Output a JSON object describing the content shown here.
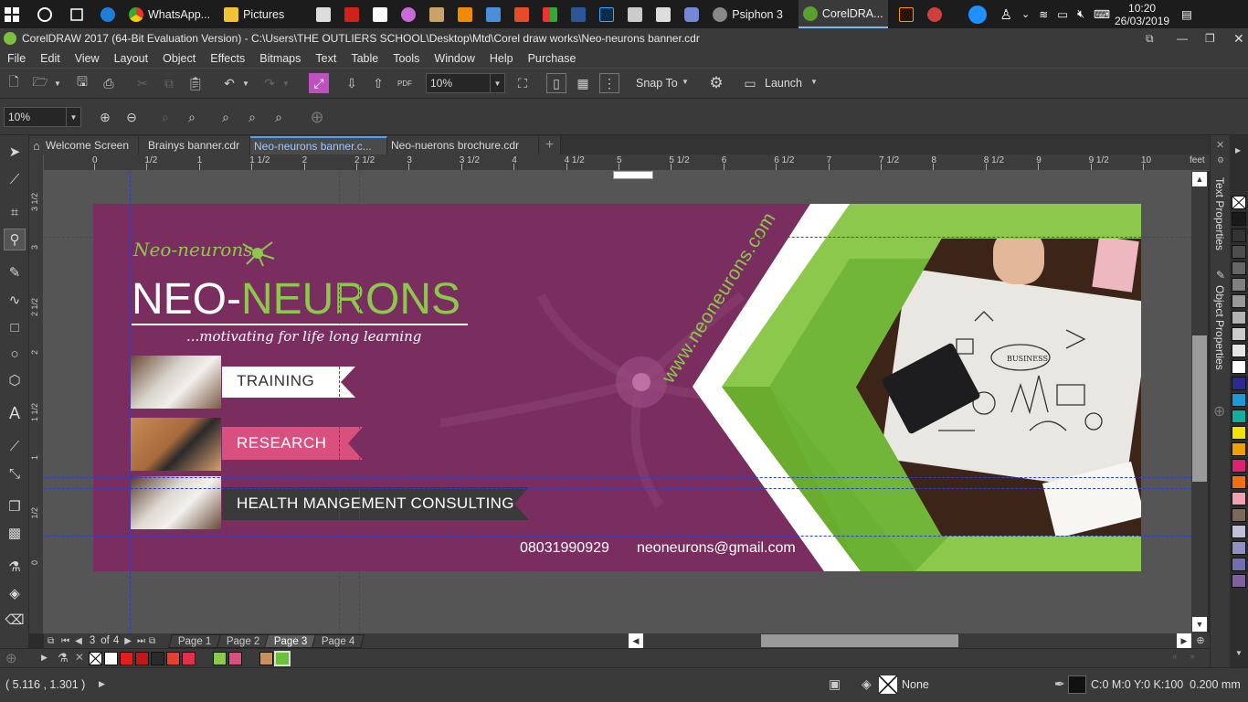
{
  "taskbar": {
    "items": [
      {
        "label": "WhatsApp...",
        "icon": "chrome-icon"
      },
      {
        "label": "Pictures",
        "icon": "folder-icon"
      },
      {
        "label": "Psiphon 3",
        "icon": "psiphon-icon"
      },
      {
        "label": "CorelDRA...",
        "icon": "coreldraw-icon"
      }
    ],
    "time": "10:20",
    "date": "26/03/2019"
  },
  "window": {
    "title": "CorelDRAW 2017 (64-Bit Evaluation Version) - C:\\Users\\THE OUTLIERS SCHOOL\\Desktop\\Mtd\\Corel draw works\\Neo-neurons banner.cdr"
  },
  "menu": [
    "File",
    "Edit",
    "View",
    "Layout",
    "Object",
    "Effects",
    "Bitmaps",
    "Text",
    "Table",
    "Tools",
    "Window",
    "Help",
    "Purchase"
  ],
  "toolbar": {
    "zoom_main": "10%",
    "pdf_label": "PDF",
    "snap_to": "Snap To",
    "launch": "Launch",
    "zoom_secondary": "10%"
  },
  "doc_tabs": [
    {
      "label": "Welcome Screen",
      "active": false
    },
    {
      "label": "Brainys banner.cdr",
      "active": false
    },
    {
      "label": "Neo-neurons banner.c...",
      "active": true
    },
    {
      "label": "Neo-nuerons brochure.cdr",
      "active": false
    }
  ],
  "ruler": {
    "h_ticks": [
      "0",
      "1/2",
      "1",
      "1 1/2",
      "2",
      "2 1/2",
      "3",
      "3 1/2",
      "4",
      "4 1/2",
      "5",
      "5 1/2",
      "6",
      "6 1/2",
      "7",
      "7 1/2",
      "8",
      "8 1/2",
      "9",
      "9 1/2",
      "10"
    ],
    "unit": "feet",
    "v_ticks": [
      "3 1/2",
      "3",
      "2 1/2",
      "2",
      "1 1/2",
      "1",
      "1/2",
      "0"
    ]
  },
  "banner": {
    "script_logo": "Neo-neurons",
    "title_part1": "NEO-",
    "title_part2": "NEURONS",
    "tagline": "...motivating for life long learning",
    "services": [
      "TRAINING",
      "RESEARCH",
      "HEALTH MANGEMENT CONSULTING"
    ],
    "phone": "08031990929",
    "email": "neoneurons@gmail.com",
    "website": "www.neoneurons.com",
    "colors": {
      "background": "#7a2e60",
      "green": "#8cc84b",
      "pink": "#d94f7e",
      "dark": "#3a3a3a"
    }
  },
  "pager": {
    "current": "3",
    "of_label": "of",
    "total": "4",
    "pages": [
      "Page 1",
      "Page 2",
      "Page 3",
      "Page 4"
    ],
    "active_page": "Page 3"
  },
  "status": {
    "coords": "( 5.116 , 1.301 )",
    "fill_label": "None",
    "outline": "C:0 M:0 Y:0 K:100  0.200 mm"
  },
  "dock": {
    "text_properties": "Text Properties",
    "object_properties": "Object Properties"
  },
  "palette_bottom": [
    "#ffffff",
    "#e02020",
    "#c01818",
    "#2a2a2a",
    "#e84030",
    "#e03050",
    "#8cc84b",
    "#d94f7e",
    "#c8905a",
    "#6cbf3a"
  ],
  "palette_right": [
    "#1a1a1a",
    "#333333",
    "#4d4d4d",
    "#666666",
    "#808080",
    "#999999",
    "#b3b3b3",
    "#cccccc",
    "#e6e6e6",
    "#ffffff",
    "#2a2a90",
    "#1a9ad6",
    "#10b0a0",
    "#f5e100",
    "#f0a000",
    "#e02070",
    "#f07010",
    "#f0a0b0",
    "#7a6a5a",
    "#c0c0d8",
    "#9090c0",
    "#7070b0",
    "#8060a0"
  ]
}
